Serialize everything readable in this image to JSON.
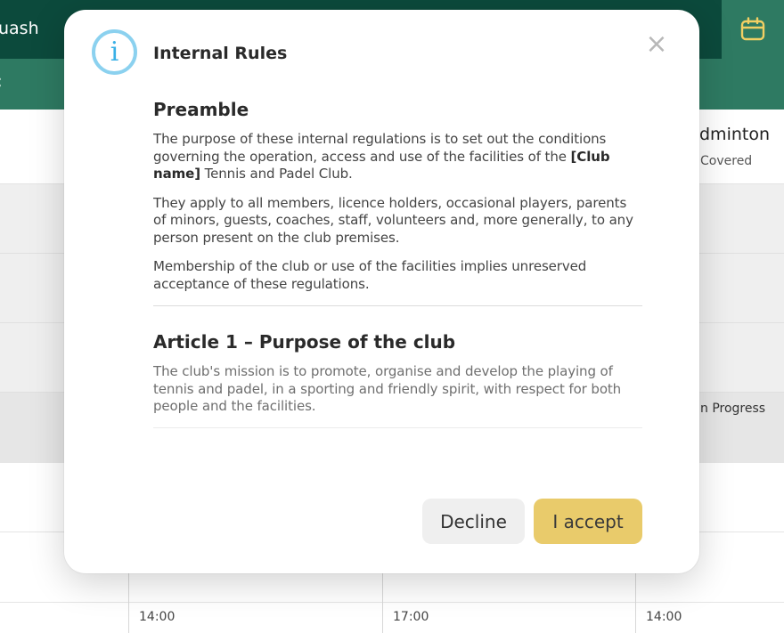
{
  "header": {
    "sport_label": "uash",
    "calendar_icon": "calendar-icon"
  },
  "subbar": {
    "chevron": "‹"
  },
  "courts": {
    "column_title": "dminton",
    "column_subtitle": "Covered",
    "status_text": "n Progress",
    "slot_times": [
      "14:00",
      "17:00",
      "14:00"
    ]
  },
  "modal": {
    "title": "Internal Rules",
    "close_glyph": "×",
    "sections": [
      {
        "heading": "Preamble",
        "paragraphs": [
          {
            "before": "The purpose of these internal regulations is to set out the conditions governing the operation, access and use of the facilities of the ",
            "bold": "[Club name]",
            "after": " Tennis and Padel Club."
          },
          "They apply to all members, licence holders, occasional players, parents of minors, guests, coaches, staff, volunteers and, more generally, to any person present on the club premises.",
          "Membership of the club or use of the facilities implies unreserved acceptance of these regulations."
        ]
      },
      {
        "heading": "Article 1 – Purpose of the club",
        "paragraphs": [
          "The club's mission is to promote, organise and develop the playing of tennis and padel, in a sporting and friendly spirit, with respect for both people and the facilities."
        ]
      }
    ],
    "decline_label": "Decline",
    "accept_label": "I accept"
  },
  "colors": {
    "header_dark": "#0c4a3c",
    "header_green": "#2e7a62",
    "accept_yellow": "#e9cb6b",
    "info_blue": "#39b0e6"
  }
}
